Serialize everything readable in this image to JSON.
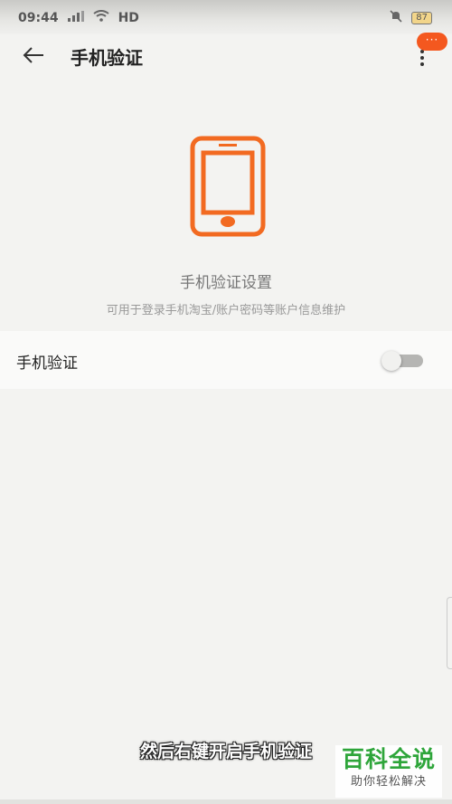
{
  "status_bar": {
    "time": "09:44",
    "network": "HD",
    "battery": "87",
    "icons": [
      "signal-icon",
      "wifi-icon",
      "mute-icon",
      "battery-icon"
    ]
  },
  "header": {
    "title": "手机验证",
    "back_icon": "back-arrow-icon",
    "menu_icon": "more-vert-icon",
    "badge": "···"
  },
  "hero": {
    "icon": "phone-icon",
    "title": "手机验证设置",
    "description": "可用于登录手机淘宝/账户密码等账户信息维护"
  },
  "setting": {
    "label": "手机验证",
    "enabled": false
  },
  "overlay": {
    "subtitle": "然后右键开启手机验证",
    "watermark_main": "百科全说",
    "watermark_sub": "助你轻松解决"
  },
  "colors": {
    "accent": "#f4581f",
    "background": "#f3f3f1",
    "watermark": "#2ea53a"
  }
}
